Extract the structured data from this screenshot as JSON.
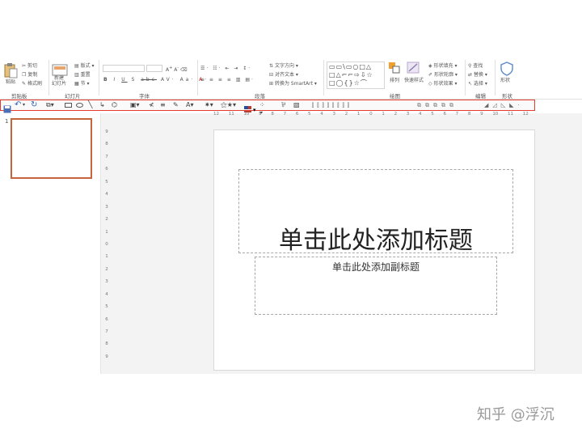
{
  "ribbon": {
    "clipboard": {
      "paste_label": "粘贴",
      "cut_label": "剪切",
      "copy_label": "复制",
      "format_painter_label": "格式刷",
      "group_label": "剪贴板"
    },
    "slides": {
      "new_slide_label": "新建\n幻灯片",
      "layout_label": "版式",
      "reset_label": "重置",
      "section_label": "节",
      "group_label": "幻灯片"
    },
    "font": {
      "group_label": "字体"
    },
    "paragraph": {
      "text_direction_label": "文字方向",
      "align_text_label": "对齐文本",
      "smartart_label": "转换为 SmartArt",
      "group_label": "段落"
    },
    "drawing": {
      "arrange_label": "排列",
      "quick_styles_label": "快速样式",
      "shape_fill_label": "形状填充",
      "shape_outline_label": "形状轮廓",
      "shape_effects_label": "形状效果",
      "group_label": "绘图"
    },
    "editing": {
      "find_label": "查找",
      "replace_label": "替换",
      "select_label": "选择",
      "group_label": "编辑"
    },
    "shapes": {
      "shape_label": "形状",
      "group_label": "形状"
    }
  },
  "ruler_h": [
    "12",
    "11",
    "10",
    "9",
    "8",
    "7",
    "6",
    "5",
    "4",
    "3",
    "2",
    "1",
    "0",
    "1",
    "2",
    "3",
    "4",
    "5",
    "6",
    "7",
    "8",
    "9",
    "10",
    "11",
    "12"
  ],
  "ruler_v": [
    "9",
    "8",
    "7",
    "6",
    "5",
    "4",
    "3",
    "2",
    "1",
    "0",
    "1",
    "2",
    "3",
    "4",
    "5",
    "6",
    "7",
    "8",
    "9"
  ],
  "thumbnail": {
    "number": "1"
  },
  "slide": {
    "title_placeholder": "单击此处添加标题",
    "subtitle_placeholder": "单击此处添加副标题"
  },
  "watermark": "知乎 @浮沉",
  "colors": {
    "accent": "#c55a11",
    "highlight": "#e33c2f",
    "selection_border": "#c8643c"
  }
}
